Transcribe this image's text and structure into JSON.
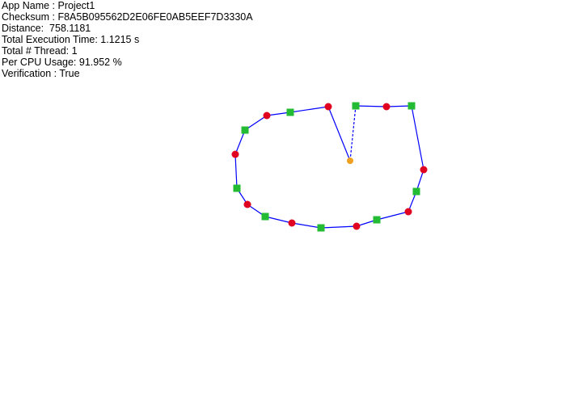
{
  "info": {
    "app_name": "App Name : Project1",
    "checksum": "Checksum : F8A5B095562D2E06FE0AB5EEF7D3330A",
    "distance": "Distance:  758.1181",
    "execution_time": "Total Execution Time: 1.1215 s",
    "thread_count": "Total # Thread: 1",
    "cpu_usage": "Per CPU Usage: 91.952 %",
    "verification": "Verification : True"
  },
  "colors": {
    "route_line": "#0000ff",
    "city_marker": "#e00020",
    "waypoint_marker": "#22bb33",
    "depot_marker": "#f0a020"
  }
}
